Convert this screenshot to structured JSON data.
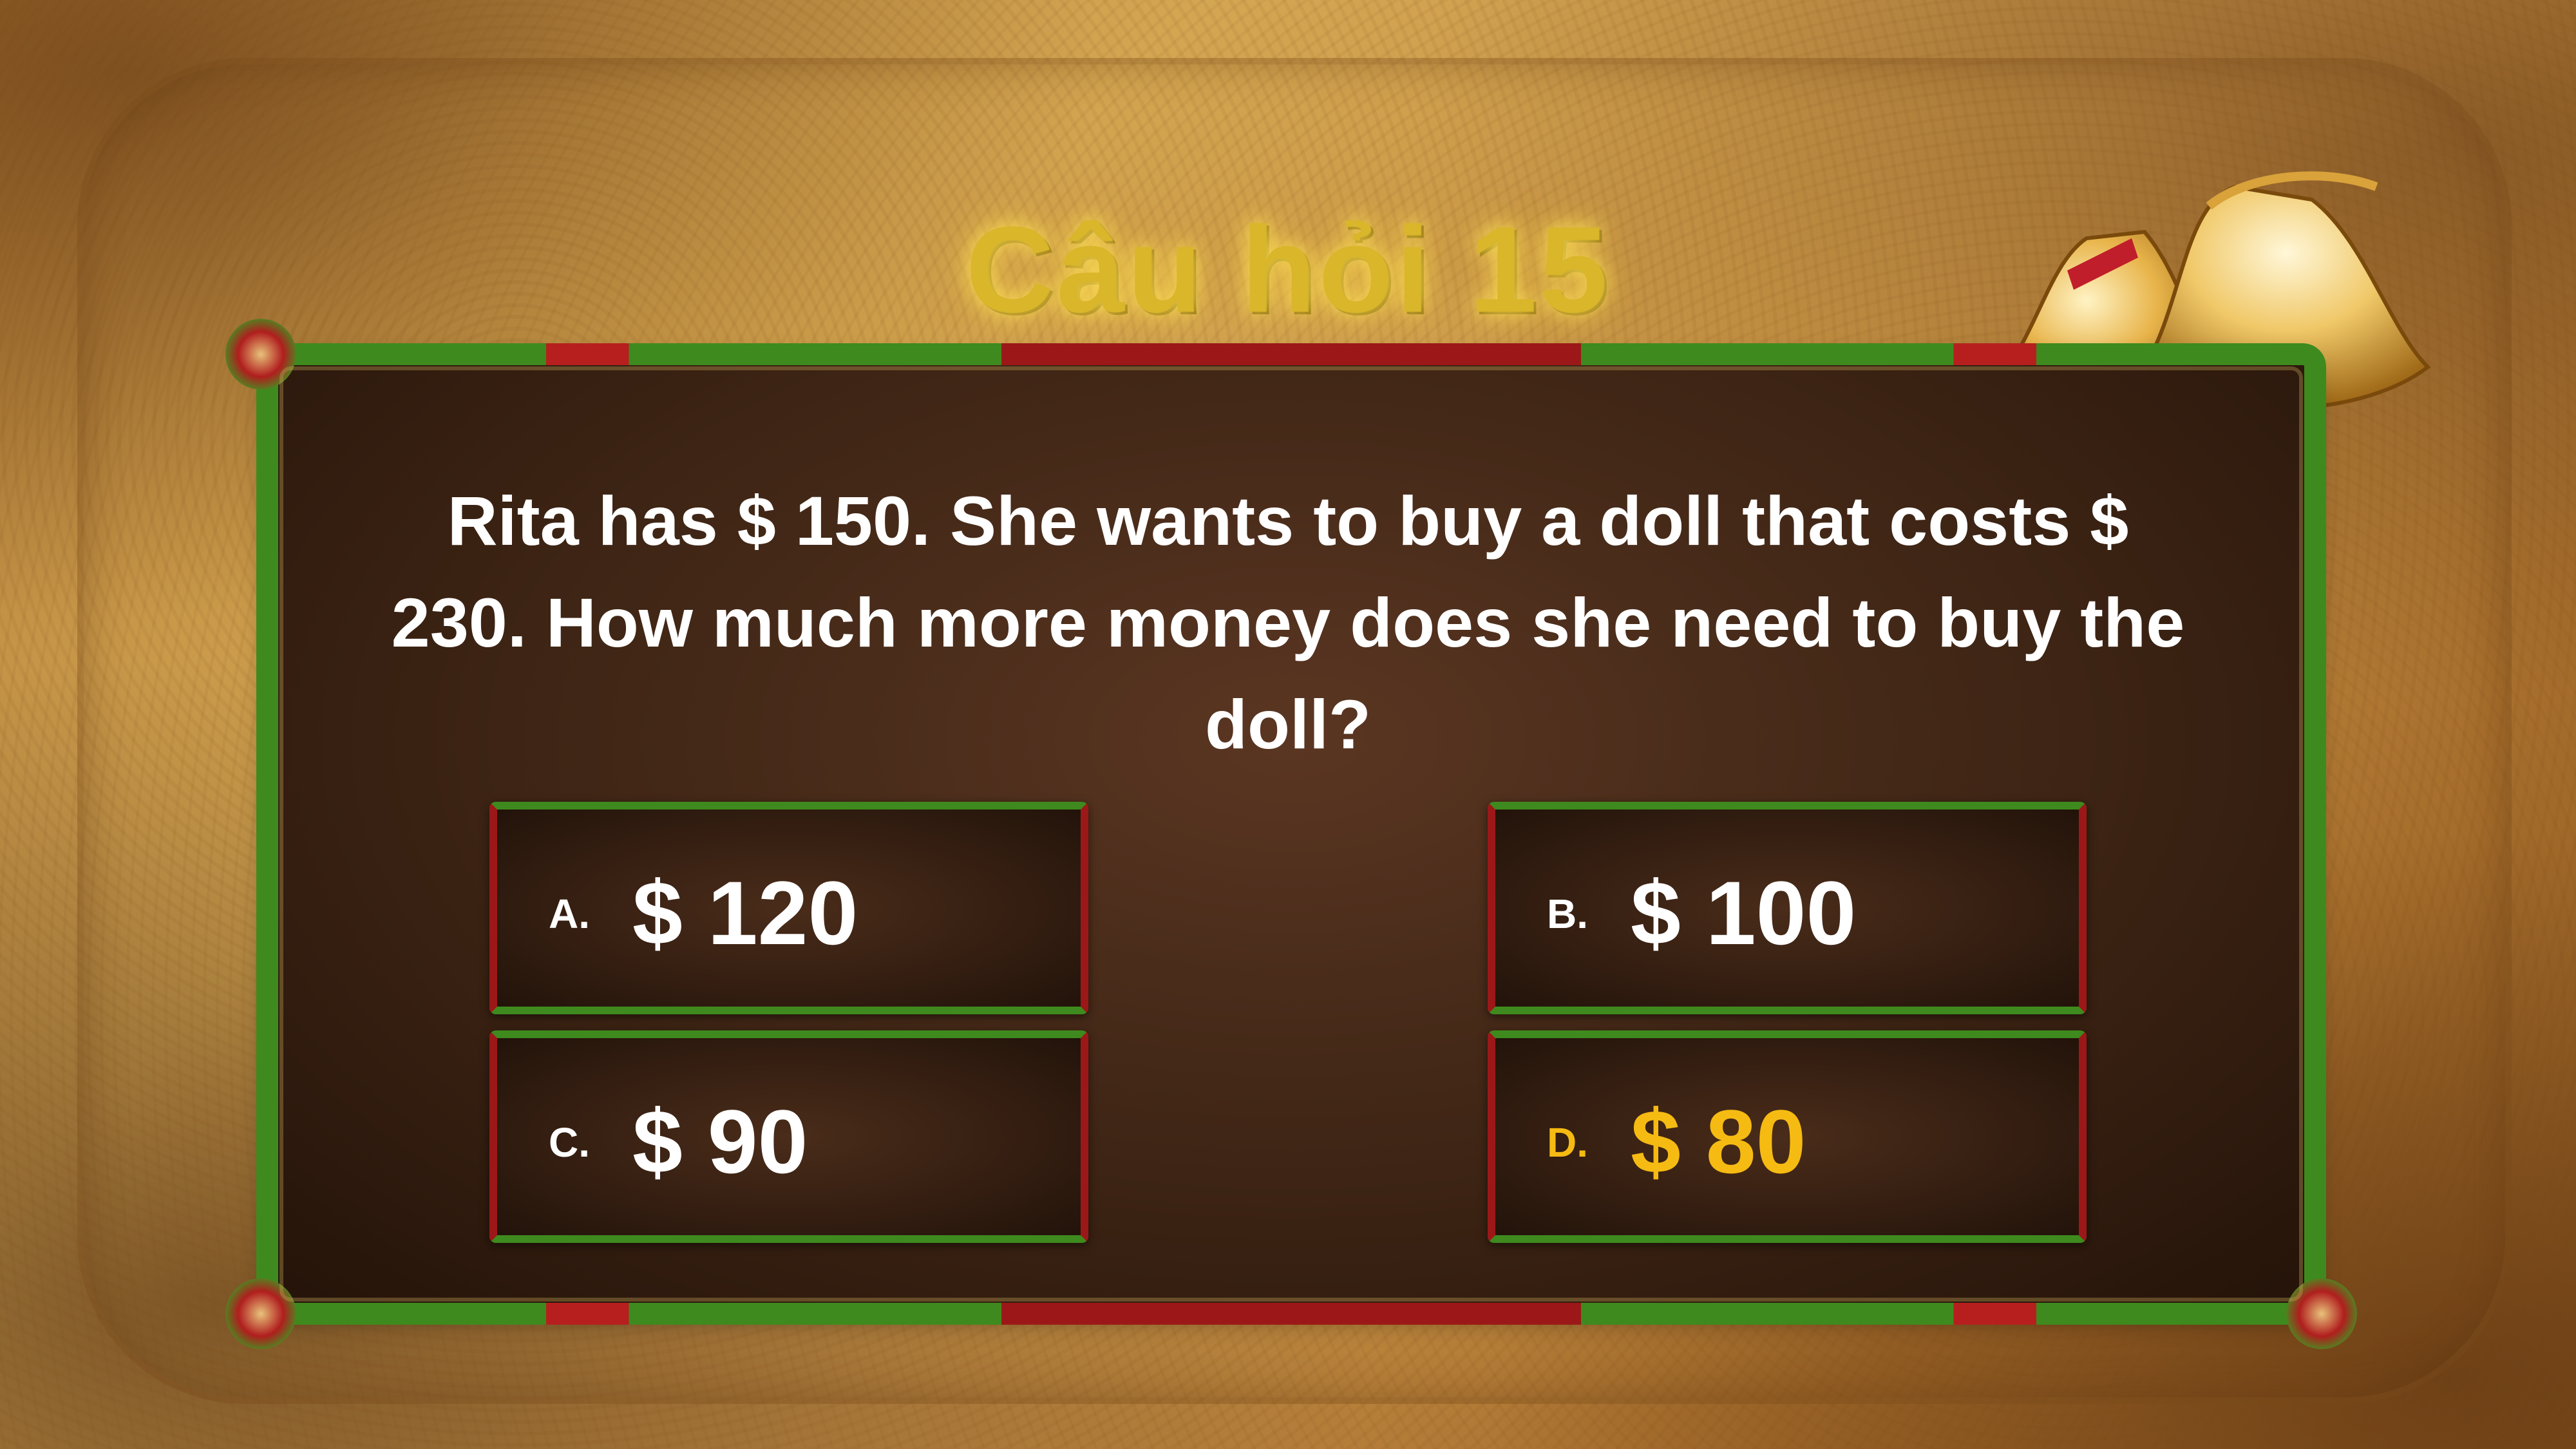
{
  "title": "Câu hỏi 15",
  "question": "Rita has $ 150. She wants to buy a doll that costs $ 230. How much more money does she need to buy the doll?",
  "answers": [
    {
      "letter": "A.",
      "value": "$ 120"
    },
    {
      "letter": "B.",
      "value": "$ 100"
    },
    {
      "letter": "C.",
      "value": "$ 90"
    },
    {
      "letter": "D.",
      "value": "$ 80"
    }
  ],
  "colors": {
    "title": "#d9b62a",
    "highlight_answer": "#f6bb12",
    "text": "#ffffff",
    "border_green": "#3e8a1e",
    "border_red": "#9c1818"
  },
  "icons": [
    "bell-icon",
    "bell-icon"
  ]
}
